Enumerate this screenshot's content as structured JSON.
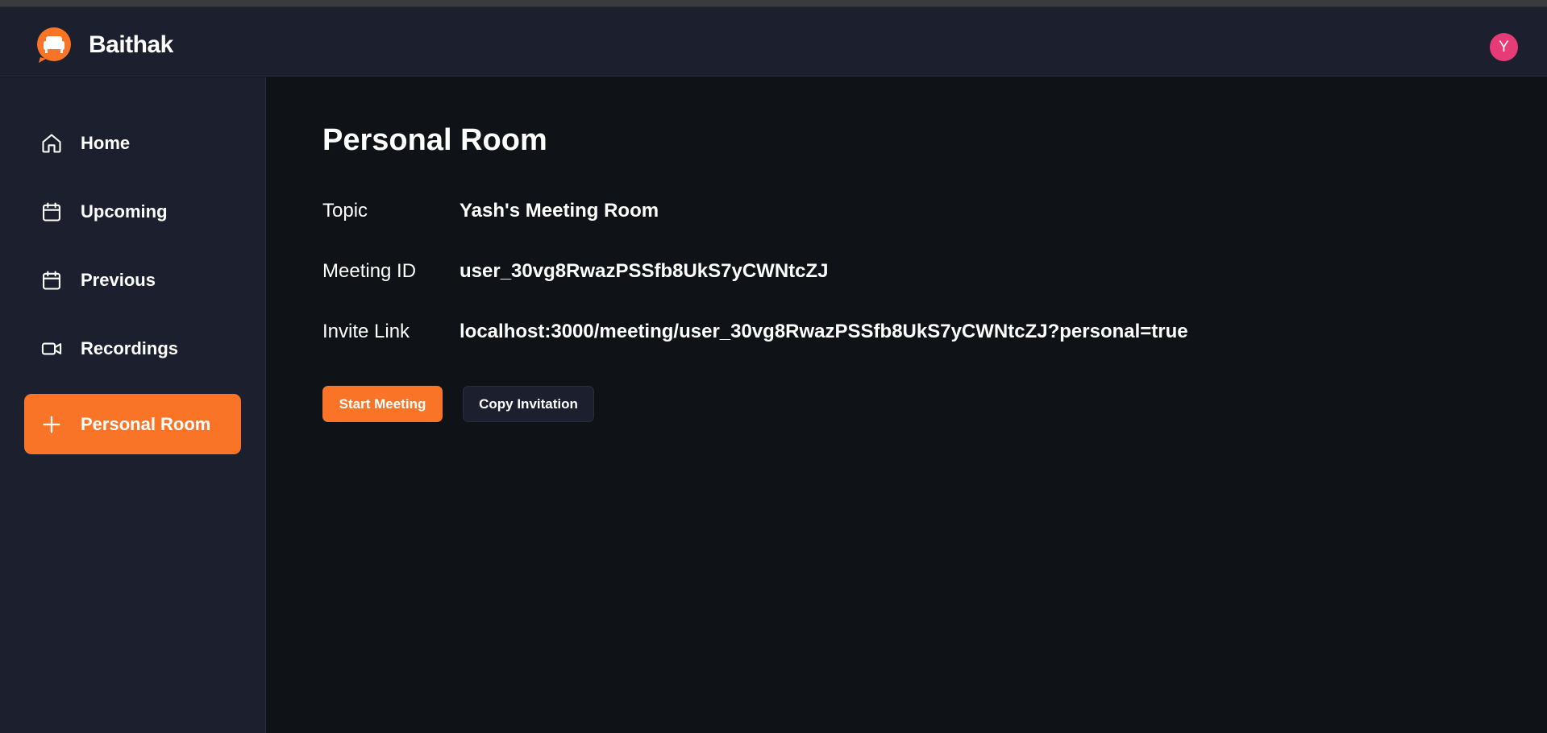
{
  "app": {
    "name": "Baithak",
    "logo_icon": "sofa-chat-logo-icon",
    "accent_color": "#f97426"
  },
  "user": {
    "avatar_initial": "Y",
    "avatar_color": "#e63b77"
  },
  "sidebar": {
    "items": [
      {
        "label": "Home",
        "icon": "home-icon",
        "active": false
      },
      {
        "label": "Upcoming",
        "icon": "calendar-icon",
        "active": false
      },
      {
        "label": "Previous",
        "icon": "calendar-icon",
        "active": false
      },
      {
        "label": "Recordings",
        "icon": "video-icon",
        "active": false
      },
      {
        "label": "Personal Room",
        "icon": "plus-icon",
        "active": true
      }
    ]
  },
  "main": {
    "title": "Personal Room",
    "details": [
      {
        "label": "Topic",
        "value": "Yash's Meeting Room"
      },
      {
        "label": "Meeting ID",
        "value": "user_30vg8RwazPSSfb8UkS7yCWNtcZJ"
      },
      {
        "label": "Invite Link",
        "value": "localhost:3000/meeting/user_30vg8RwazPSSfb8UkS7yCWNtcZJ?personal=true"
      }
    ],
    "actions": {
      "start_label": "Start Meeting",
      "copy_label": "Copy Invitation"
    }
  }
}
